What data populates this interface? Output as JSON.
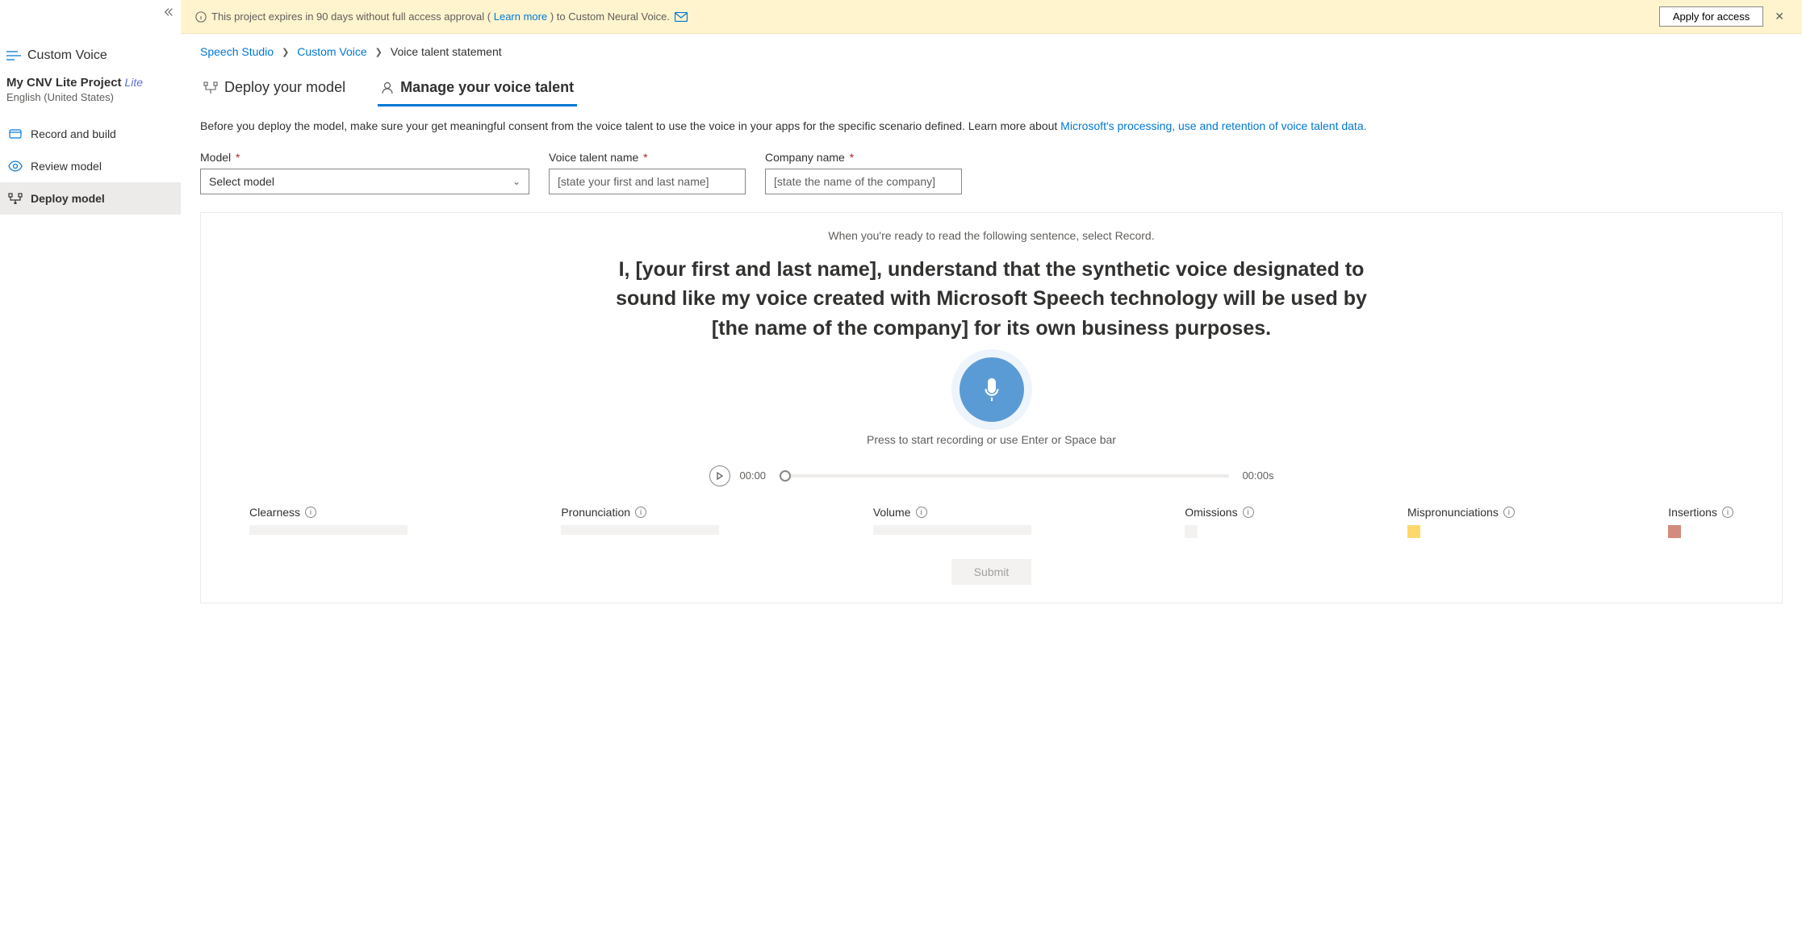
{
  "sidebar": {
    "title": "Custom Voice",
    "project_name": "My CNV Lite Project",
    "project_badge": "Lite",
    "project_lang": "English (United States)",
    "nav": [
      {
        "label": "Record and build"
      },
      {
        "label": "Review model"
      },
      {
        "label": "Deploy model"
      }
    ]
  },
  "banner": {
    "text_pre": "This project expires in 90 days without full access approval (",
    "learn_more": "Learn more",
    "text_post": ") to Custom Neural Voice.",
    "apply_btn": "Apply for access"
  },
  "breadcrumb": {
    "root": "Speech Studio",
    "mid": "Custom Voice",
    "current": "Voice talent statement"
  },
  "tabs": {
    "deploy": "Deploy your model",
    "manage": "Manage your voice talent"
  },
  "intro": {
    "text": "Before you deploy the model, make sure your get meaningful consent from the voice talent to use the voice in your apps for the specific scenario defined. Learn more about ",
    "link": "Microsoft's processing, use and retention of voice talent data."
  },
  "form": {
    "model_label": "Model",
    "model_placeholder": "Select model",
    "talent_label": "Voice talent name",
    "talent_placeholder": "[state your first and last name]",
    "company_label": "Company name",
    "company_placeholder": "[state the name of the company]"
  },
  "panel": {
    "ready": "When you're ready to read the following sentence, select Record.",
    "statement": "I, [your first and last name], understand that the synthetic voice designated to sound like my voice created with Microsoft Speech technology will be used by [the name of the company] for its own business purposes.",
    "rec_hint": "Press to start recording or use Enter or Space bar",
    "time_start": "00:00",
    "time_end": "00:00s",
    "metrics": {
      "clearness": "Clearness",
      "pronunciation": "Pronunciation",
      "volume": "Volume",
      "omissions": "Omissions",
      "mispron": "Mispronunciations",
      "insertions": "Insertions"
    },
    "submit": "Submit"
  }
}
